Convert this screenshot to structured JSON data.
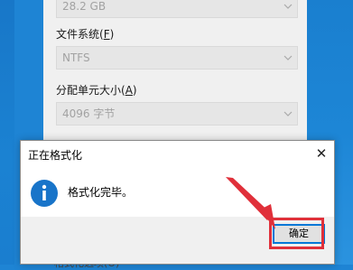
{
  "format_window": {
    "capacity_value": "28.2 GB",
    "fs_label_prefix": "文件系统(",
    "fs_label_key": "F",
    "fs_label_suffix": ")",
    "fs_value": "NTFS",
    "alloc_label_prefix": "分配单元大小(",
    "alloc_label_key": "A",
    "alloc_label_suffix": ")",
    "alloc_value": "4096 字节",
    "bottom_fragment": "格式化选项(O)"
  },
  "dialog": {
    "title": "正在格式化",
    "close_symbol": "✕",
    "message": "格式化完毕。",
    "ok_label": "确定"
  },
  "colors": {
    "desktop": "#1e84d4",
    "highlight": "#e0303a",
    "info_icon": "#1874c9"
  }
}
